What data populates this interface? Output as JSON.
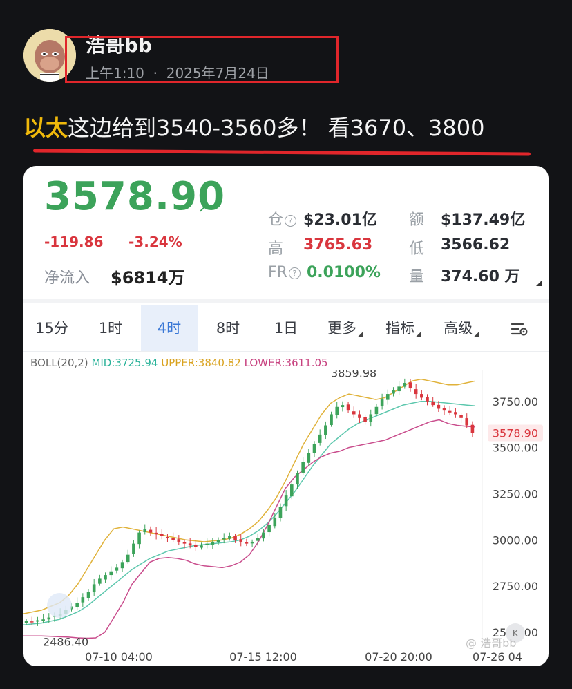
{
  "post": {
    "username": "浩哥bb",
    "time": "上午1:10",
    "date": "2025年7月24日",
    "text_highlight": "以太",
    "text_rest": "这边给到3540-3560多！ 看3670、3800"
  },
  "ticker": {
    "price": "3578.90",
    "change": "-119.86",
    "change_pct": "-3.24%",
    "netflow_label": "净流入",
    "netflow_value": "$6814万",
    "stats": {
      "oi_label": "仓",
      "oi_value": "$23.01亿",
      "turnover_label": "额",
      "turnover_value": "$137.49亿",
      "high_label": "高",
      "high_value": "3765.63",
      "low_label": "低",
      "low_value": "3566.62",
      "fr_label": "FR",
      "fr_value": "0.0100%",
      "volume_label": "量",
      "volume_value": "374.60 万"
    }
  },
  "tabs": [
    "15分",
    "1时",
    "4时",
    "8时",
    "1日",
    "更多",
    "指标",
    "高级"
  ],
  "active_tab": "4时",
  "indicator": {
    "name": "BOLL(20,2)",
    "mid": "MID:3725.94",
    "upper": "UPPER:3840.82",
    "lower": "LOWER:3611.05"
  },
  "chart_data": {
    "type": "candlestick",
    "y_ticks": [
      3750,
      3500,
      3250,
      3000,
      2750,
      2500
    ],
    "ylim": [
      2440,
      3880
    ],
    "x_ticks": [
      "07-10 04:00",
      "07-15 12:00",
      "07-20 20:00",
      "07-26 04"
    ],
    "current_price": 3578.9,
    "high_label": 3859.98,
    "low_label": 2486.4,
    "close_series": [
      2560,
      2555,
      2565,
      2570,
      2580,
      2590,
      2600,
      2620,
      2640,
      2660,
      2690,
      2720,
      2760,
      2790,
      2810,
      2830,
      2850,
      2880,
      2920,
      2980,
      3040,
      3060,
      3040,
      3030,
      3020,
      3010,
      3000,
      2990,
      2980,
      2970,
      2960,
      2970,
      2980,
      2990,
      3000,
      3010,
      3020,
      3000,
      2990,
      2980,
      2990,
      3010,
      3040,
      3080,
      3120,
      3180,
      3240,
      3300,
      3360,
      3420,
      3470,
      3520,
      3570,
      3620,
      3680,
      3720,
      3730,
      3700,
      3680,
      3660,
      3640,
      3680,
      3720,
      3760,
      3790,
      3810,
      3830,
      3850,
      3820,
      3790,
      3770,
      3750,
      3730,
      3710,
      3700,
      3690,
      3680,
      3660,
      3620,
      3579
    ],
    "upper_band": [
      2600,
      2610,
      2620,
      2640,
      2660,
      2700,
      2760,
      2840,
      2920,
      3000,
      3060,
      3070,
      3060,
      3050,
      3040,
      3030,
      3020,
      3010,
      3000,
      2995,
      2990,
      2995,
      3000,
      3010,
      3030,
      3060,
      3100,
      3160,
      3230,
      3320,
      3420,
      3520,
      3600,
      3680,
      3740,
      3770,
      3790,
      3780,
      3770,
      3760,
      3770,
      3800,
      3830,
      3860,
      3870,
      3860,
      3850,
      3840,
      3840,
      3850,
      3860
    ],
    "mid_band": [
      2540,
      2545,
      2550,
      2560,
      2570,
      2590,
      2610,
      2640,
      2680,
      2720,
      2760,
      2800,
      2840,
      2870,
      2900,
      2920,
      2940,
      2950,
      2960,
      2970,
      2975,
      2980,
      2985,
      2990,
      3000,
      3020,
      3050,
      3090,
      3140,
      3200,
      3260,
      3330,
      3400,
      3460,
      3520,
      3560,
      3600,
      3630,
      3650,
      3670,
      3690,
      3710,
      3730,
      3740,
      3750,
      3750,
      3745,
      3740,
      3735,
      3730,
      3726
    ],
    "lower_band": [
      2480,
      2480,
      2480,
      2478,
      2476,
      2474,
      2470,
      2468,
      2470,
      2500,
      2580,
      2660,
      2760,
      2820,
      2880,
      2900,
      2905,
      2900,
      2890,
      2870,
      2860,
      2855,
      2850,
      2860,
      2880,
      2920,
      2990,
      3080,
      3180,
      3280,
      3340,
      3380,
      3420,
      3450,
      3470,
      3480,
      3500,
      3510,
      3520,
      3530,
      3540,
      3560,
      3580,
      3600,
      3620,
      3640,
      3650,
      3630,
      3620,
      3615,
      3611
    ]
  },
  "watermark": "浩哥bb"
}
